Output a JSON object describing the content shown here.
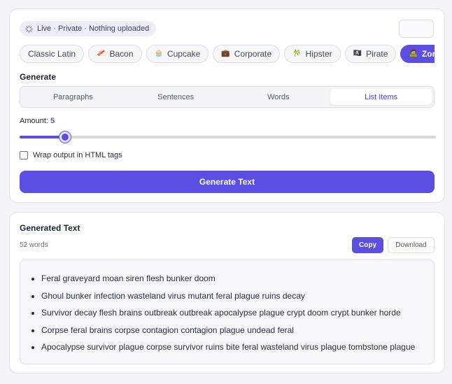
{
  "status": {
    "text": "Live · Private · Nothing uploaded",
    "icon": "spinner-icon"
  },
  "themes": [
    {
      "label": "Classic Latin",
      "emoji": "",
      "icon": ""
    },
    {
      "label": "Bacon",
      "emoji": "🥓",
      "icon": "bacon-icon"
    },
    {
      "label": "Cupcake",
      "emoji": "🧁",
      "icon": "cupcake-icon"
    },
    {
      "label": "Corporate",
      "emoji": "💼",
      "icon": "briefcase-icon"
    },
    {
      "label": "Hipster",
      "emoji": "🎋",
      "icon": "bamboo-icon"
    },
    {
      "label": "Pirate",
      "emoji": "🏴‍☠️",
      "icon": "pirate-flag-icon"
    },
    {
      "label": "Zombie",
      "emoji": "🧟",
      "icon": "zombie-icon"
    }
  ],
  "active_theme": "Zombie",
  "generate": {
    "label": "Generate",
    "modes": [
      "Paragraphs",
      "Sentences",
      "Words",
      "List Items"
    ],
    "active_mode": "List Items"
  },
  "amount": {
    "label": "Amount:",
    "value": "5",
    "fraction": 0.095
  },
  "wrap_html": {
    "label": "Wrap output in HTML tags",
    "checked": false
  },
  "generate_button": "Generate Text",
  "output": {
    "title": "Generated Text",
    "word_count": "52 words",
    "copy_label": "Copy",
    "download_label": "Download",
    "items": [
      "Feral graveyard moan siren flesh bunker doom",
      "Ghoul bunker infection wasteland virus mutant feral plague ruins decay",
      "Survivor decay flesh brains outbreak outbreak apocalypse plague crypt doom crypt bunker horde",
      "Corpse feral brains corpse contagion contagion plague undead feral",
      "Apocalypse survivor plague corpse survivor ruins bite feral wasteland virus plague tombstone plague"
    ]
  },
  "colors": {
    "accent": "#5b4fe3",
    "background": "#f4f4f6"
  }
}
